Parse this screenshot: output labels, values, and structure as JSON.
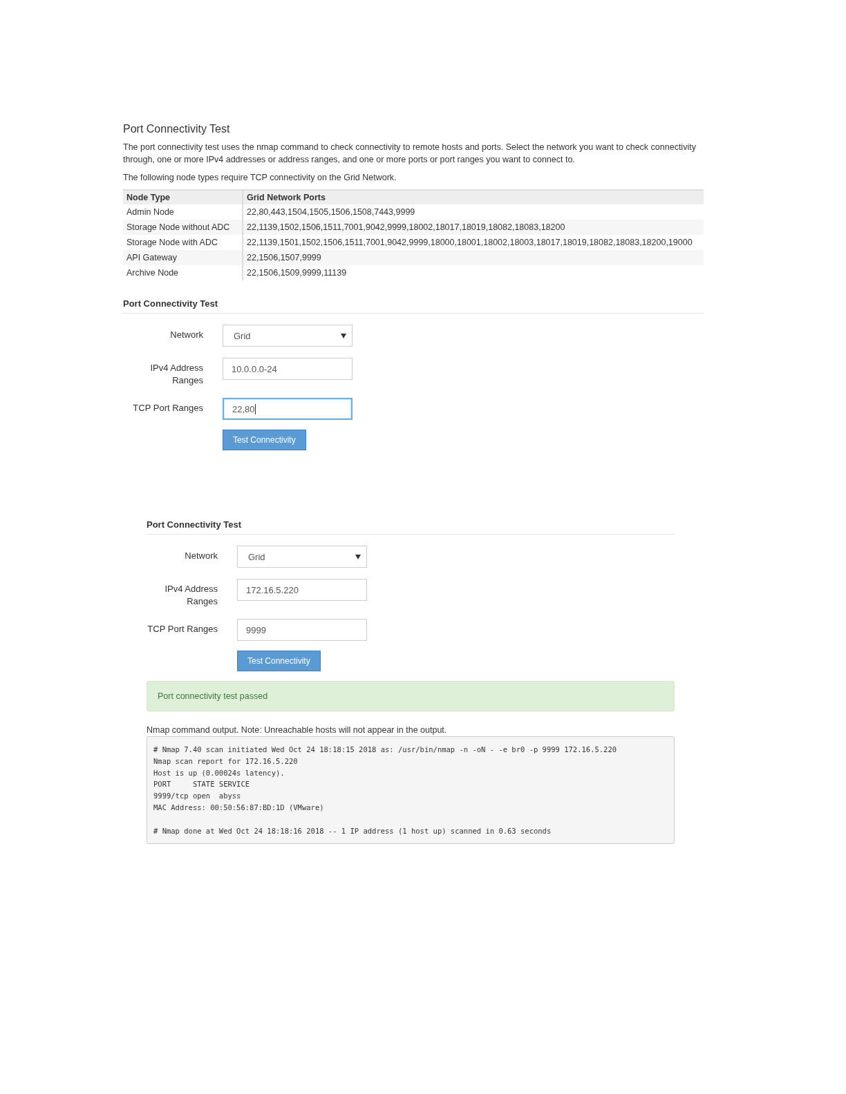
{
  "intro": {
    "title": "Port Connectivity Test",
    "paragraphs": [
      "The port connectivity test uses the nmap command to check connectivity to remote hosts and ports. Select the network you want to check connectivity through, one or more IPv4 addresses or address ranges, and one or more ports or port ranges you want to connect to.",
      "The following node types require TCP connectivity on the Grid Network."
    ]
  },
  "ports_table": {
    "columns": [
      "Node Type",
      "Grid Network Ports"
    ],
    "rows": [
      {
        "node_type": "Admin Node",
        "ports": "22,80,443,1504,1505,1506,1508,7443,9999"
      },
      {
        "node_type": "Storage Node without ADC",
        "ports": "22,1139,1502,1506,1511,7001,9042,9999,18002,18017,18019,18082,18083,18200"
      },
      {
        "node_type": "Storage Node with ADC",
        "ports": "22,1139,1501,1502,1506,1511,7001,9042,9999,18000,18001,18002,18003,18017,18019,18082,18083,18200,19000"
      },
      {
        "node_type": "API Gateway",
        "ports": "22,1506,1507,9999"
      },
      {
        "node_type": "Archive Node",
        "ports": "22,1506,1509,9999,11139"
      }
    ]
  },
  "forms": [
    {
      "heading": "Port Connectivity Test",
      "fields": [
        {
          "kind": "select",
          "label": "Network",
          "value": "Grid"
        },
        {
          "kind": "text",
          "label": "IPv4 Address Ranges",
          "value": "10.0.0.0-24",
          "focused": false
        },
        {
          "kind": "text",
          "label": "TCP Port Ranges",
          "value": "22,80",
          "focused": true
        }
      ],
      "button": "Test Connectivity"
    },
    {
      "heading": "Port Connectivity Test",
      "fields": [
        {
          "kind": "select",
          "label": "Network",
          "value": "Grid"
        },
        {
          "kind": "text",
          "label": "IPv4 Address Ranges",
          "value": "172.16.5.220",
          "focused": false
        },
        {
          "kind": "text",
          "label": "TCP Port Ranges",
          "value": "9999",
          "focused": false
        }
      ],
      "button": "Test Connectivity",
      "result": {
        "alert": "Port connectivity test passed",
        "output_note": "Nmap command output. Note: Unreachable hosts will not appear in the output.",
        "output": "# Nmap 7.40 scan initiated Wed Oct 24 18:18:15 2018 as: /usr/bin/nmap -n -oN - -e br0 -p 9999 172.16.5.220\nNmap scan report for 172.16.5.220\nHost is up (0.00024s latency).\nPORT     STATE SERVICE\n9999/tcp open  abyss\nMAC Address: 00:50:56:87:BD:1D (VMware)\n\n# Nmap done at Wed Oct 24 18:18:16 2018 -- 1 IP address (1 host up) scanned in 0.63 seconds"
      }
    }
  ]
}
